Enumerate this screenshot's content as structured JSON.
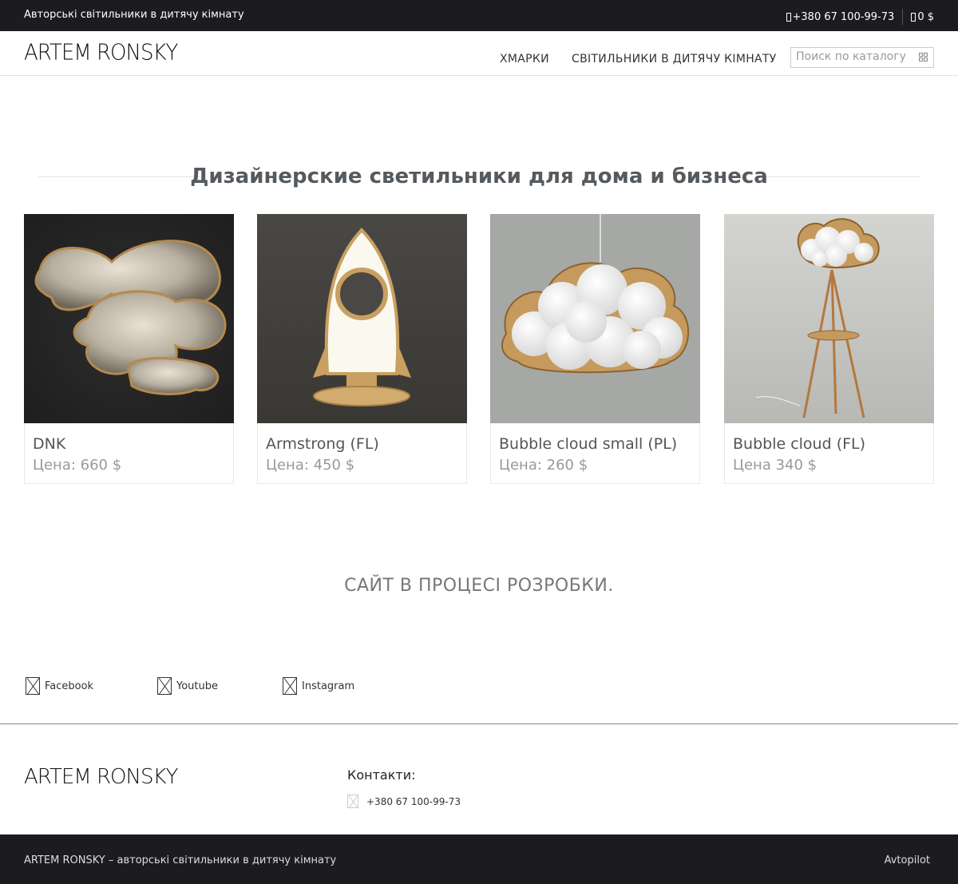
{
  "topbar": {
    "tagline": "Авторські світильники в дитячу кімнату",
    "phone": "+380 67 100-99-73",
    "cart": "0 $"
  },
  "header": {
    "logo": "ARTEM RONSKY",
    "nav": [
      "ХМАРКИ",
      "СВІТИЛЬНИКИ В ДИТЯЧУ КІМНАТУ"
    ],
    "search_placeholder": "Поиск по каталогу"
  },
  "main": {
    "heading": "Дизайнерские светильники для дома и бизнеса",
    "products": [
      {
        "name": "DNK",
        "price": "Цена: 660 $"
      },
      {
        "name": "Armstrong (FL)",
        "price": "Цена: 450 $"
      },
      {
        "name": "Bubble cloud small (PL)",
        "price": "Цена: 260 $"
      },
      {
        "name": "Bubble cloud (FL)",
        "price": "Цена 340 $"
      }
    ],
    "notice": "САЙТ В ПРОЦЕСІ РОЗРОБКИ."
  },
  "social": [
    {
      "label": "Facebook"
    },
    {
      "label": "Youtube"
    },
    {
      "label": "Instagram"
    }
  ],
  "footer_block": {
    "logo": "ARTEM RONSKY",
    "contacts_title": "Контакти:",
    "phone": "+380 67 100-99-73"
  },
  "footer": {
    "copyright": "ARTEM RONSKY – авторські світильники в дитячу кімнату",
    "credit": "Avtopilot"
  },
  "colors": {
    "bar_bg": "#1c1b1f",
    "heading": "#555a5f",
    "price": "#999999"
  }
}
